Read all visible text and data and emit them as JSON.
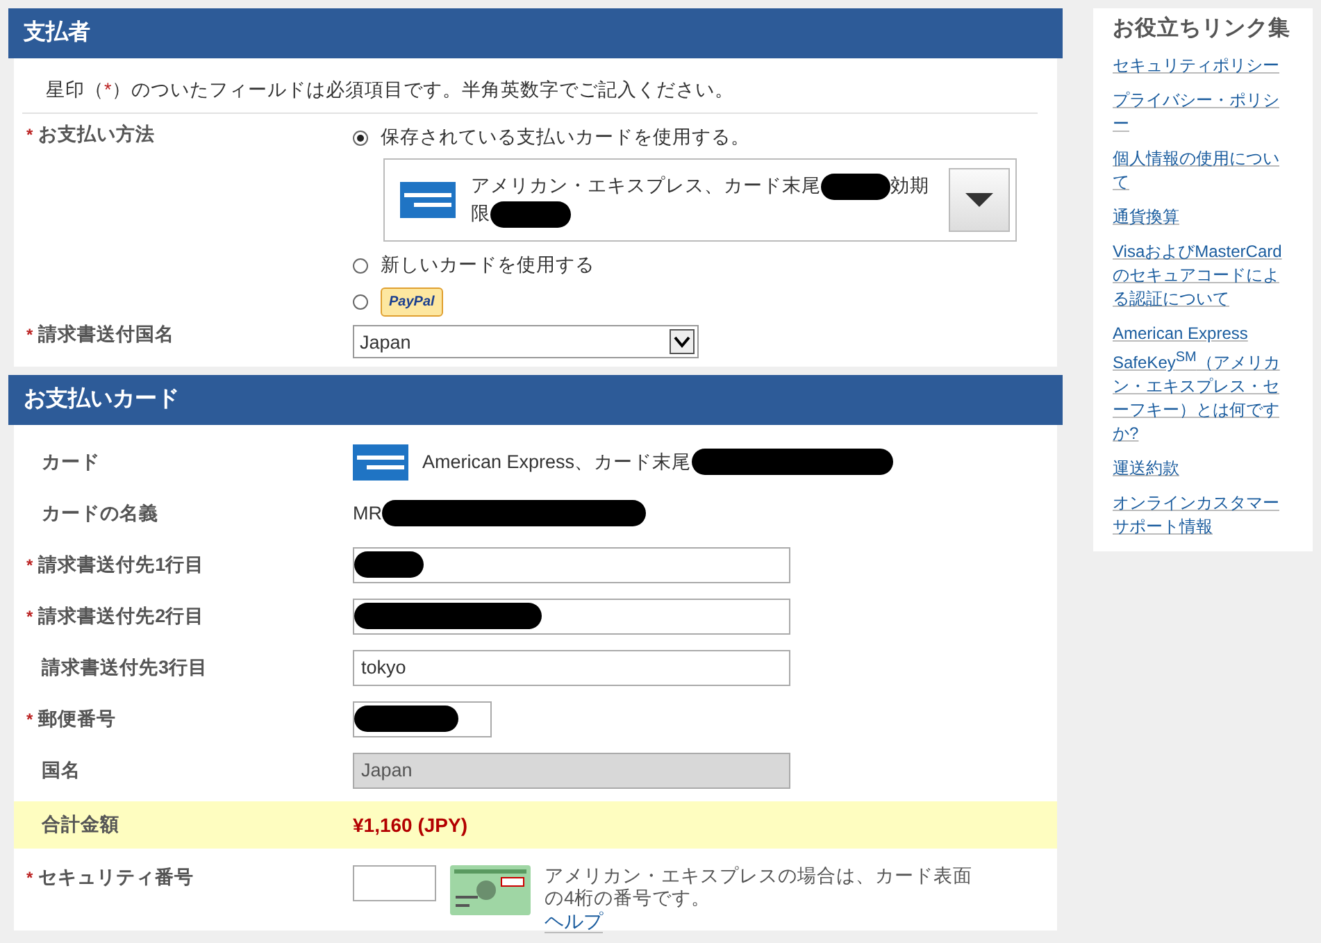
{
  "required_mark": "*",
  "payer": {
    "title": "支払者",
    "notice": {
      "before": "星印（",
      "mark": "*",
      "after": "）のついたフィールドは必須項目です。半角英数字でご記入ください。"
    },
    "payment_method": {
      "label": "お支払い方法",
      "required": true,
      "options": [
        {
          "kind": "saved_card",
          "selected": true,
          "label": "保存されている支払いカードを使用する。",
          "card_text": "アメリカン・エキスプレス、カード末尾",
          "card_text_after": "効期",
          "card_text_line2": "限"
        },
        {
          "kind": "new_card",
          "selected": false,
          "label": "新しいカードを使用する"
        },
        {
          "kind": "paypal",
          "selected": false,
          "label": "PayPal"
        }
      ]
    },
    "billing_country": {
      "label": "請求書送付国名",
      "required": true,
      "value": "Japan"
    }
  },
  "card_section": {
    "title": "お支払いカード",
    "rows": [
      {
        "kind": "card",
        "label": "カード",
        "required": false,
        "value": "American Express、カード末尾",
        "redacted": true
      },
      {
        "kind": "text",
        "label": "カードの名義",
        "required": false,
        "value": "MR",
        "redacted": true
      },
      {
        "kind": "input",
        "label": "請求書送付先1行目",
        "required": true,
        "value": "",
        "redacted": true
      },
      {
        "kind": "input",
        "label": "請求書送付先2行目",
        "required": true,
        "value": "",
        "redacted": true
      },
      {
        "kind": "input",
        "label": "請求書送付先3行目",
        "required": false,
        "value": "tokyo",
        "redacted": false
      },
      {
        "kind": "short_input",
        "label": "郵便番号",
        "required": true,
        "value": "",
        "redacted": true
      },
      {
        "kind": "disabled_input",
        "label": "国名",
        "required": false,
        "value": "Japan",
        "redacted": false
      }
    ],
    "total": {
      "label": "合計金額",
      "value": "¥1,160 (JPY)"
    },
    "security": {
      "label": "セキュリティ番号",
      "required": true,
      "hint": "アメリカン・エキスプレスの場合は、カード表面の4桁の番号です。",
      "help": "ヘルプ"
    }
  },
  "sidebar": {
    "title": "お役立ちリンク集",
    "links": [
      "セキュリティポリシー",
      "プライバシー・ポリシー",
      "個人情報の使用について",
      "通貨換算",
      "VisaおよびMasterCardのセキュアコードによる認証について",
      "American Express SafeKey$^{SM}$（アメリカン・エキスプレス・セーフキー）とは何ですか?",
      "運送約款",
      "オンラインカスタマーサポート情報"
    ]
  }
}
